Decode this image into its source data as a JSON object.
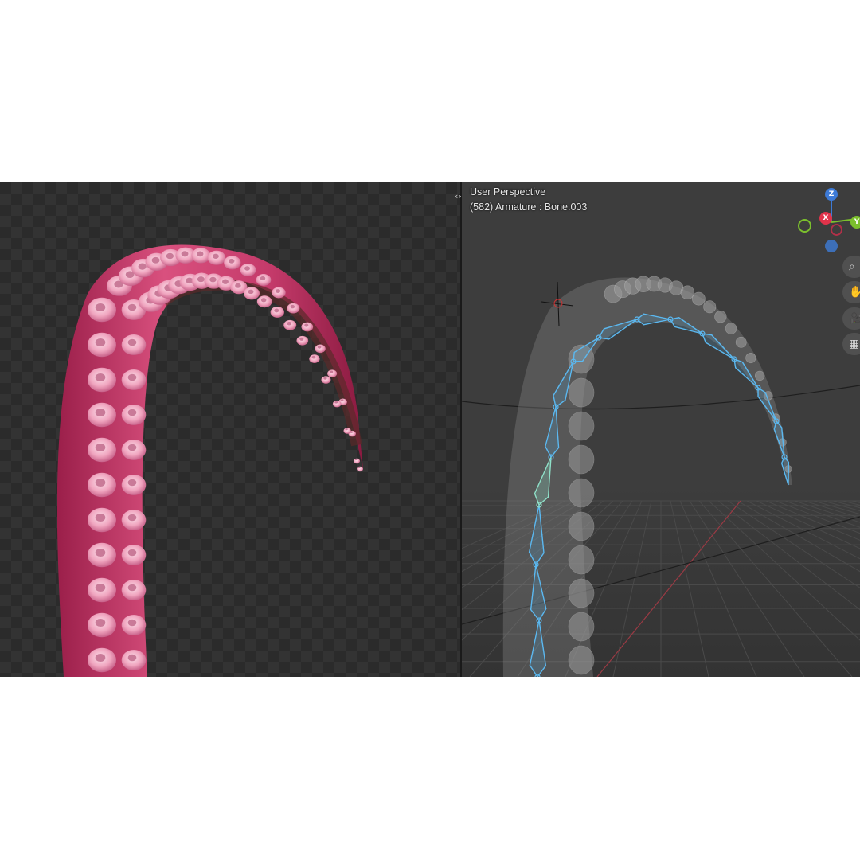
{
  "viewport": {
    "view_name": "User Perspective",
    "object_info": "(582) Armature : Bone.003"
  },
  "header_toggle": "‹›",
  "gizmo": {
    "z_label": "Z",
    "x_label": "X",
    "y_label": "Y",
    "colors": {
      "x": "#e0334a",
      "y": "#7bbf2d",
      "z": "#3d7ad6",
      "neg": "#3d6fb8"
    }
  },
  "nav_buttons": [
    {
      "name": "zoom-icon",
      "glyph": "⌕"
    },
    {
      "name": "hand-pan-icon",
      "glyph": "✋"
    },
    {
      "name": "camera-icon",
      "glyph": "🎥"
    },
    {
      "name": "grid-icon",
      "glyph": "▦"
    }
  ],
  "colors": {
    "tentacle_pink": "#d9507e",
    "sucker_pink": "#f0a5bf",
    "bone_blue": "#5bb8f0",
    "bone_selected": "#8fe0c8"
  }
}
